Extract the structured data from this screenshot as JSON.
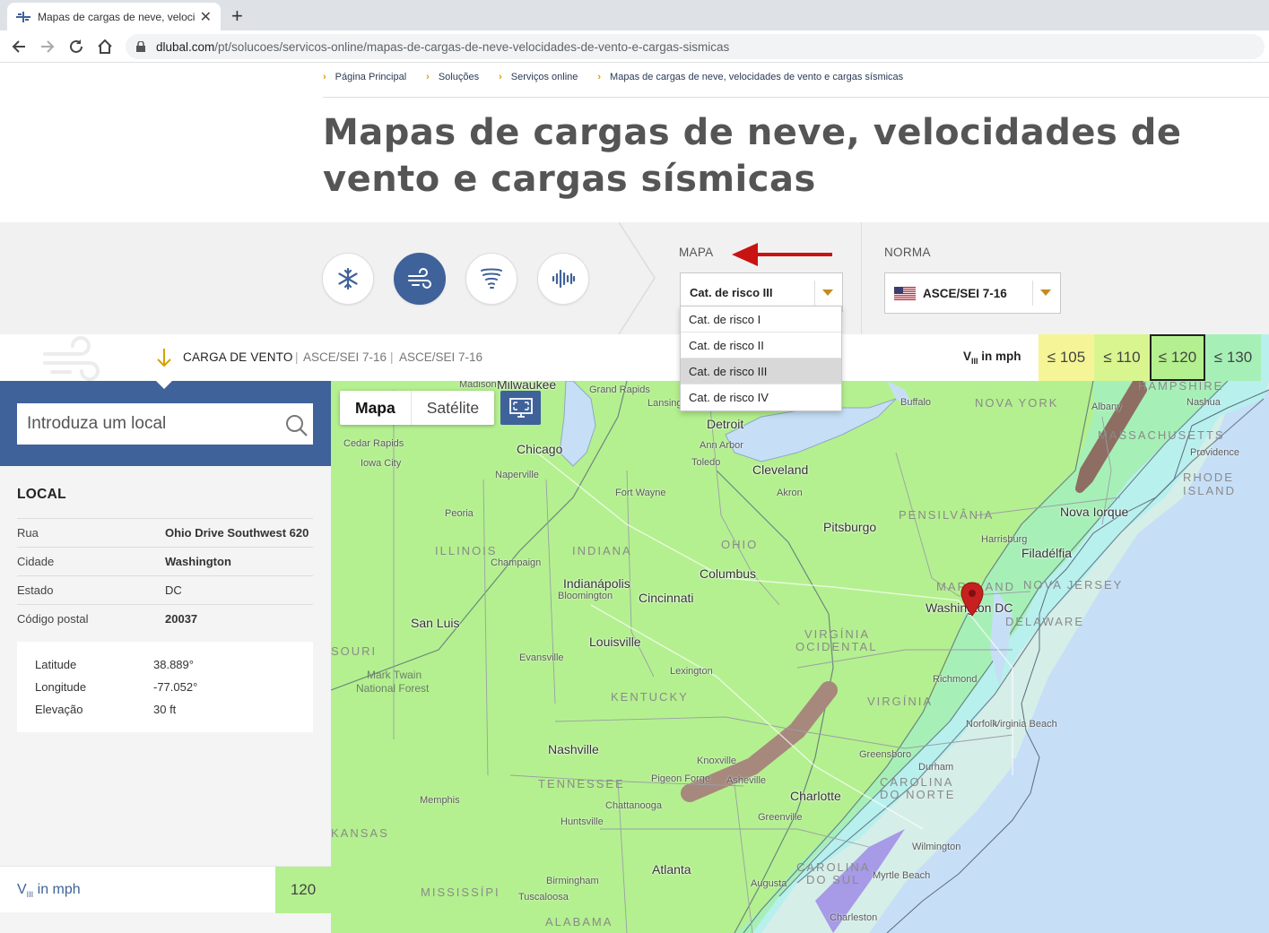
{
  "browser": {
    "tab_title": "Mapas de cargas de neve, velocid",
    "url_host": "dlubal.com",
    "url_path": "/pt/solucoes/servicos-online/mapas-de-cargas-de-neve-velocidades-de-vento-e-cargas-sismicas"
  },
  "breadcrumb": [
    "Página Principal",
    "Soluções",
    "Serviços online",
    "Mapas de cargas de neve, velocidades de vento e cargas sísmicas"
  ],
  "page_title": "Mapas de cargas de neve, velocidades de vento e cargas sísmicas",
  "load_types": [
    {
      "name": "snow",
      "icon": "snowflake-icon",
      "active": false
    },
    {
      "name": "wind",
      "icon": "wind-icon",
      "active": true
    },
    {
      "name": "tornado",
      "icon": "tornado-icon",
      "active": false
    },
    {
      "name": "seismic",
      "icon": "seismic-wave-icon",
      "active": false
    }
  ],
  "map_selector": {
    "label": "MAPA",
    "value": "Cat. de risco III",
    "options": [
      "Cat. de risco I",
      "Cat. de risco II",
      "Cat. de risco III",
      "Cat. de risco IV"
    ],
    "selected_index": 2
  },
  "norm_selector": {
    "label": "NORMA",
    "value": "ASCE/SEI 7-16"
  },
  "strip": {
    "load_label": "CARGA DE VENTO",
    "norm1": "ASCE/SEI 7-16",
    "norm2": "ASCE/SEI 7-16",
    "unit_prefix": "V",
    "unit_sub": "III",
    "unit_suffix": " in mph"
  },
  "legend": [
    {
      "label": "≤ 105",
      "color": "#f5f597",
      "current": false
    },
    {
      "label": "≤ 110",
      "color": "#d9f590",
      "current": false
    },
    {
      "label": "≤ 120",
      "color": "#b4f08f",
      "current": true
    },
    {
      "label": "≤ 130",
      "color": "#a6f0b7",
      "current": false
    }
  ],
  "sidebar": {
    "search_placeholder": "Introduza um local",
    "local_heading": "LOCAL",
    "address": [
      {
        "key": "Rua",
        "value": "Ohio Drive Southwest 620"
      },
      {
        "key": "Cidade",
        "value": "Washington"
      },
      {
        "key": "Estado",
        "value": "DC"
      },
      {
        "key": "Código postal",
        "value": "20037"
      }
    ],
    "coords": [
      {
        "key": "Latitude",
        "value": "38.889°"
      },
      {
        "key": "Longitude",
        "value": "-77.052°"
      },
      {
        "key": "Elevação",
        "value": "30 ft"
      }
    ],
    "result_prefix": "V",
    "result_sub": "III",
    "result_suffix": " in mph",
    "result_value": "120"
  },
  "map": {
    "type_buttons": [
      "Mapa",
      "Satélite"
    ],
    "cities": [
      "Milwaukee",
      "Grand Rapids",
      "Lansing",
      "Detroit",
      "Buffalo",
      "Albany",
      "Nashua",
      "Chicago",
      "Cedar Rapids",
      "Iowa City",
      "Naperville",
      "Ann Arbor",
      "Toledo",
      "Cleveland",
      "Akron",
      "Fort Wayne",
      "Peoria",
      "Pitsburgo",
      "Harrisburg",
      "Providence",
      "Nova Iorque",
      "Filadélfia",
      "Champaign",
      "Columbus",
      "Indianápolis",
      "Bloomington",
      "Cincinnati",
      "San Luis",
      "Washington DC",
      "Louisville",
      "Evansville",
      "Lexington",
      "Richmond",
      "Virginia Beach",
      "Norfolk",
      "Nashville",
      "Knoxville",
      "Pigeon Forge",
      "Asheville",
      "Greensboro",
      "Durham",
      "Charlotte",
      "Memphis",
      "Chattanooga",
      "Greenville",
      "Huntsville",
      "Atlanta",
      "Birmingham",
      "Augusta",
      "Wilmington",
      "Myrtle Beach",
      "Tuscaloosa",
      "Charleston",
      "Madison",
      "Mark Twain",
      "National Forest"
    ],
    "states": [
      "NOVA YORK",
      "MASSACHUSETTS",
      "RHODE",
      "ISLAND",
      "PENSILVÂNIA",
      "ILLINOIS",
      "INDIANA",
      "OHIO",
      "NOVA JERSEY",
      "MARYLAND",
      "DELAWARE",
      "VIRGÍNIA",
      "OCIDENTAL",
      "VIRGÍNIA",
      "KENTUCKY",
      "TENNESSEE",
      "CAROLINA",
      "DO NORTE",
      "CAROLINA",
      "DO SUL",
      "KANSAS",
      "MISSISSÍPI",
      "ALABAMA",
      "SOURI",
      "HAMPSHIRE"
    ]
  },
  "colors": {
    "brand_blue": "#3f629a",
    "accent_gold": "#d4a200",
    "arrow_red": "#c91313"
  }
}
